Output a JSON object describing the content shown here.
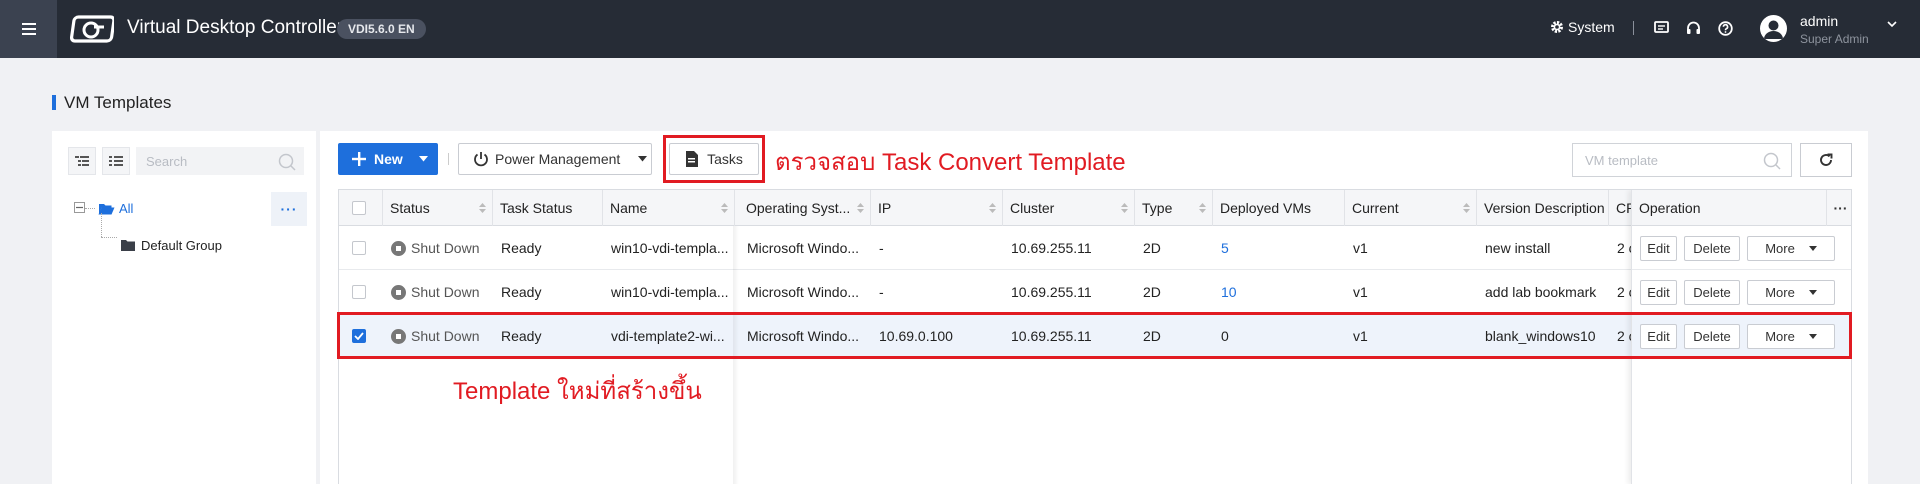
{
  "header": {
    "app_title": "Virtual Desktop Controller",
    "version": "VDI5.6.0 EN",
    "system_label": "System",
    "user_name": "admin",
    "user_role": "Super Admin"
  },
  "page": {
    "title": "VM Templates"
  },
  "sidebar": {
    "search_placeholder": "Search",
    "tree_root": "All",
    "tree_more": "···",
    "group": "Default Group"
  },
  "toolbar": {
    "new_label": "New",
    "power_label": "Power Management",
    "tasks_label": "Tasks",
    "search_placeholder": "VM template"
  },
  "annotations": {
    "tasks_note": "ตรวจสอบ Task Convert Template",
    "row_note": "Template ใหม่ที่สร้างขึ้น"
  },
  "table": {
    "columns": [
      "Status",
      "Task Status",
      "Name",
      "Operating Syst...",
      "IP",
      "Cluster",
      "Type",
      "Deployed VMs",
      "Current",
      "Version Description",
      "CP"
    ],
    "operation_header": "Operation",
    "operation_more": "···",
    "rows": [
      {
        "checked": false,
        "status": "Shut Down",
        "task_status": "Ready",
        "name": "win10-vdi-templa...",
        "os": "Microsoft Windo...",
        "ip": "-",
        "cluster": "10.69.255.11",
        "type": "2D",
        "deployed": "5",
        "current": "v1",
        "desc": "new install",
        "cpu": "2 c"
      },
      {
        "checked": false,
        "status": "Shut Down",
        "task_status": "Ready",
        "name": "win10-vdi-templa...",
        "os": "Microsoft Windo...",
        "ip": "-",
        "cluster": "10.69.255.11",
        "type": "2D",
        "deployed": "10",
        "current": "v1",
        "desc": "add lab bookmark",
        "cpu": "2 c"
      },
      {
        "checked": true,
        "status": "Shut Down",
        "task_status": "Ready",
        "name": "vdi-template2-wi...",
        "os": "Microsoft Windo...",
        "ip": "10.69.0.100",
        "cluster": "10.69.255.11",
        "type": "2D",
        "deployed": "0",
        "current": "v1",
        "desc": "blank_windows10",
        "cpu": "2 c"
      }
    ],
    "actions": {
      "edit": "Edit",
      "delete": "Delete",
      "more": "More"
    }
  },
  "colors": {
    "accent": "#1e6fdc",
    "highlight": "#e11b22",
    "topbar": "#262c36"
  }
}
